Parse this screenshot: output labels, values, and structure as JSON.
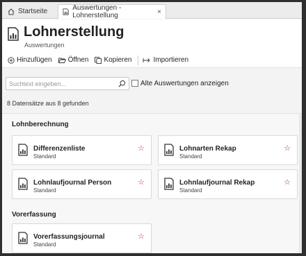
{
  "tabs": [
    {
      "label": "Startseite",
      "icon": "home-icon"
    },
    {
      "label": "Auswertungen - Lohnerstellung",
      "icon": "report-icon",
      "close": "×"
    }
  ],
  "header": {
    "title": "Lohnerstellung",
    "subtitle": "Auswertungen",
    "icon": "report-icon"
  },
  "toolbar": {
    "add_label": "Hinzufügen",
    "open_label": "Öffnen",
    "copy_label": "Kopieren",
    "import_label": "Importieren"
  },
  "search": {
    "placeholder": "Suchtext eingeben..."
  },
  "filter": {
    "old_label": "Alte Auswertungen anzeigen"
  },
  "status": {
    "count_text": "8 Datensätze aus 8 gefunden"
  },
  "groups": [
    {
      "title": "Lohnberechnung",
      "items": [
        {
          "title": "Differenzenliste",
          "sub": "Standard"
        },
        {
          "title": "Lohnarten Rekap",
          "sub": "Standard"
        },
        {
          "title": "Lohnlaufjournal Person",
          "sub": "Standard"
        },
        {
          "title": "Lohnlaufjournal Rekap",
          "sub": "Standard"
        }
      ]
    },
    {
      "title": "Vorerfassung",
      "items": [
        {
          "title": "Vorerfassungsjournal",
          "sub": "Standard"
        }
      ]
    }
  ],
  "colors": {
    "star": "#b0234d",
    "accent": "#333333"
  }
}
